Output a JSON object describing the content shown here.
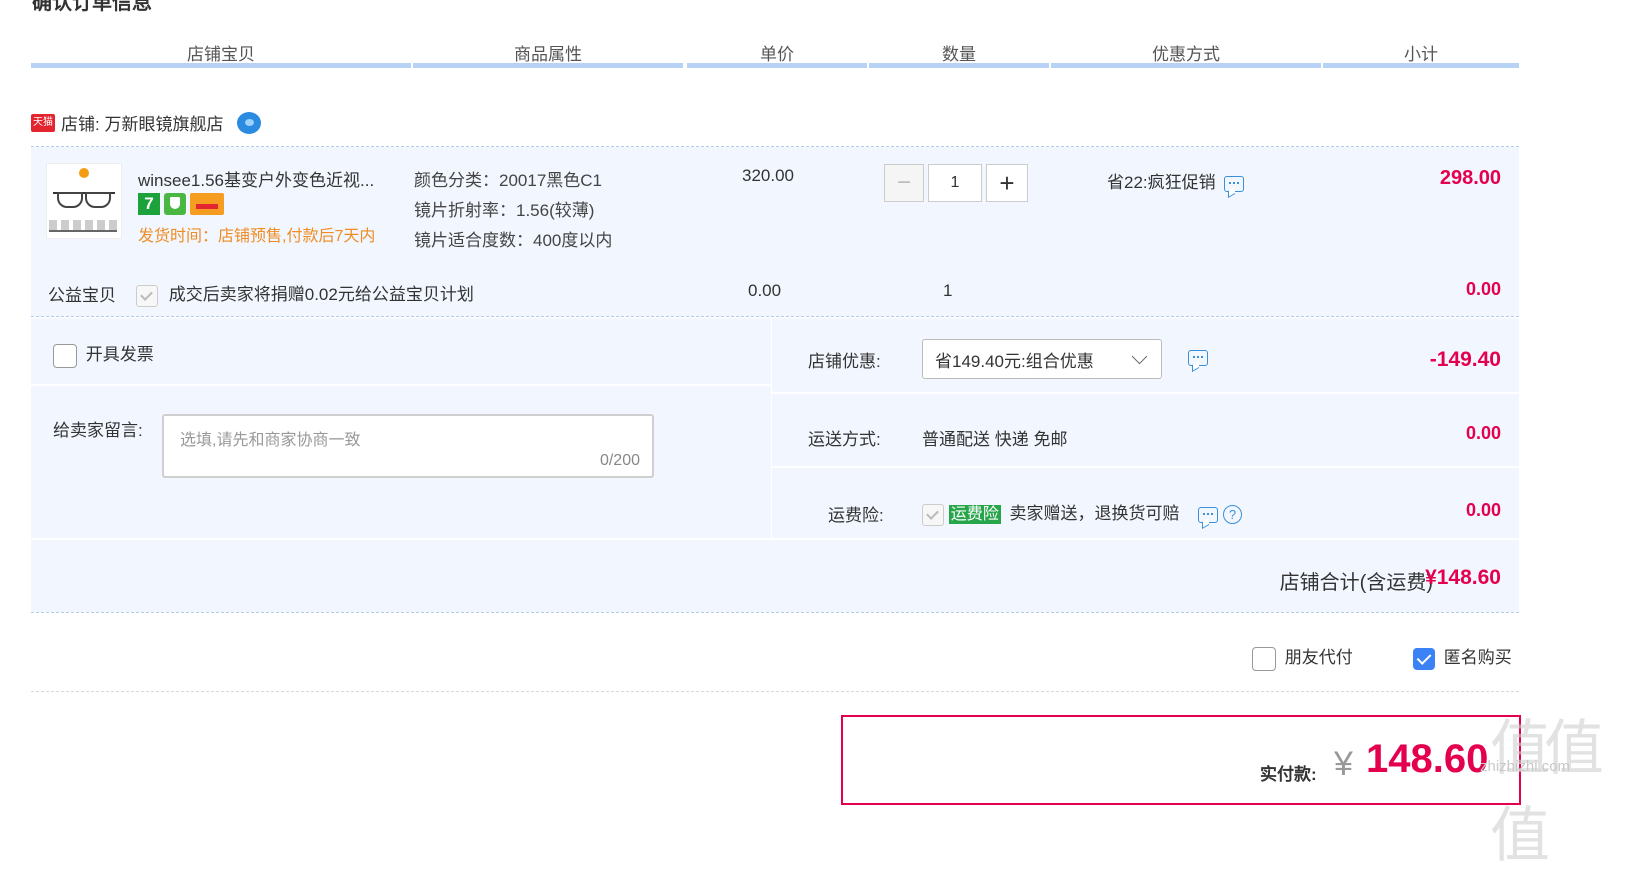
{
  "page_title": "确认订单信息",
  "columns": [
    "店铺宝贝",
    "商品属性",
    "单价",
    "数量",
    "优惠方式",
    "小计"
  ],
  "shop": {
    "tmall_badge": "天猫",
    "name": "店铺: 万新眼镜旗舰店"
  },
  "item": {
    "title": "winsee1.56基变户外变色近视...",
    "badges": {
      "seven": "7"
    },
    "shipping": "发货时间：店铺预售,付款后7天内",
    "attrs": [
      "颜色分类：20017黑色C1",
      "镜片折射率：1.56(较薄)",
      "镜片适合度数：400度以内"
    ],
    "unit_price": "320.00",
    "quantity": "1",
    "promo": "省22:疯狂促销",
    "subtotal": "298.00"
  },
  "charity": {
    "label": "公益宝贝",
    "text": "成交后卖家将捐赠0.02元给公益宝贝计划",
    "price": "0.00",
    "quantity": "1",
    "subtotal": "0.00"
  },
  "invoice": {
    "label": "开具发票"
  },
  "message": {
    "label": "给卖家留言:",
    "placeholder": "选填,请先和商家协商一致",
    "count": "0/200"
  },
  "shop_discount": {
    "label": "店铺优惠:",
    "selected": "省149.40元:组合优惠",
    "amount": "-149.40"
  },
  "delivery": {
    "label": "运送方式:",
    "value": "普通配送 快递 免邮",
    "amount": "0.00"
  },
  "insurance": {
    "label": "运费险:",
    "tag": "运费险",
    "text": "卖家赠送，退换货可赔",
    "amount": "0.00"
  },
  "shop_total": {
    "label": "店铺合计(含运费)",
    "value": "¥148.60"
  },
  "options": {
    "friend_pay": "朋友代付",
    "anonymous": "匿名购买"
  },
  "payment": {
    "label": "实付款:",
    "currency": "¥",
    "value": "148.60"
  },
  "watermark": {
    "logo": "值值值",
    "site": "zhizhizhi.com"
  },
  "colors": {
    "price_red": "#e4004f",
    "header_bar": "#b7d2f5",
    "panel_bg": "#f2f7ff",
    "ship_orange": "#f08c23",
    "insurance_green": "#27a54a",
    "checkbox_blue": "#3b82f6"
  }
}
